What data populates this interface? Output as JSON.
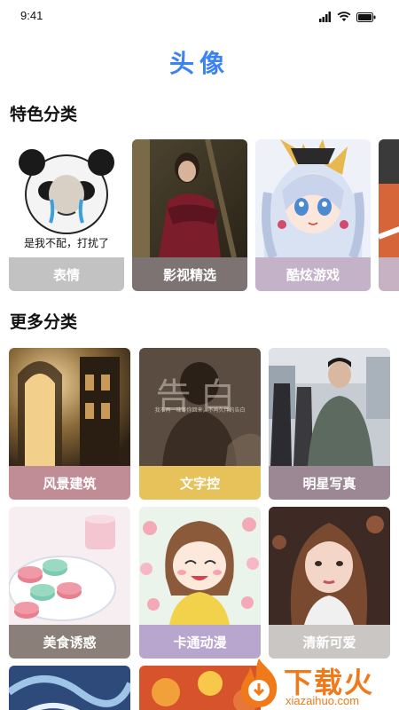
{
  "status_bar": {
    "time": "9:41"
  },
  "page_title": "头像",
  "colors": {
    "title_blue": "#3b82f6",
    "card_label_bg": "rgba(120,110,110,0.85)"
  },
  "sections": {
    "featured": {
      "title": "特色分类",
      "cards": [
        {
          "label": "表情",
          "caption": "是我不配，打扰了",
          "label_color": "#c2c2c2"
        },
        {
          "label": "影视精选",
          "label_color": "#7d7372"
        },
        {
          "label": "酷炫游戏",
          "label_color": "#c4b3c8"
        },
        {
          "label": "",
          "label_color": "#c7b2c3"
        }
      ]
    },
    "more": {
      "title": "更多分类",
      "cards": [
        {
          "label": "风景建筑",
          "label_color": "#c08c95"
        },
        {
          "label": "文字控",
          "label_color": "#e7c15a"
        },
        {
          "label": "明星写真",
          "label_color": "#9c8894"
        },
        {
          "label": "美食诱惑",
          "label_color": "#8a7f79"
        },
        {
          "label": "卡通动漫",
          "label_color": "#b9a6cf"
        },
        {
          "label": "清新可爱",
          "label_color": "#c9c6c4"
        }
      ]
    }
  },
  "poster_text": {
    "big": "告白",
    "small": "我不再一味等你回来，不再久伴的告白"
  },
  "watermark": {
    "main": "下载火",
    "url": "xiazaihuo.com"
  }
}
